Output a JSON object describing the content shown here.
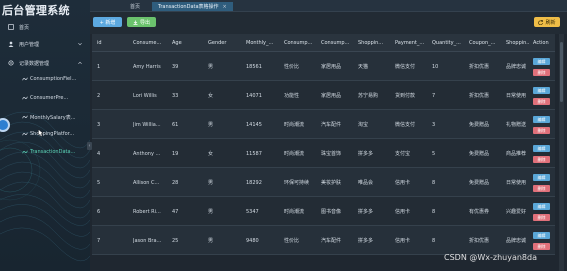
{
  "app": {
    "title": "后台管理系统"
  },
  "sidebar": {
    "items": [
      {
        "label": "首页",
        "icon": "home-icon"
      },
      {
        "label": "用户管理",
        "icon": "user-icon"
      },
      {
        "label": "记录数据管理",
        "icon": "data-icon"
      }
    ],
    "subitems": [
      {
        "label": "ConsumptionFiel..."
      },
      {
        "label": "ConsumerPre..."
      },
      {
        "label": "MonthlySalary表..."
      },
      {
        "label": "ShoppingPlatfor..."
      },
      {
        "label": "TransactionData..."
      }
    ]
  },
  "tabs": [
    {
      "label": "首页"
    },
    {
      "label": "TransactionData表格操作"
    }
  ],
  "toolbar": {
    "add_label": "+ 新增",
    "export_label": "导出",
    "refresh_label": "刷新"
  },
  "table": {
    "columns": [
      "id",
      "Consume...",
      "Age",
      "Gender",
      "Monthly_...",
      "Consump...",
      "Consump...",
      "Shoppin...",
      "Payment_...",
      "Quantity_...",
      "Coupon_...",
      "Shoppin...",
      "Action"
    ],
    "rows": [
      {
        "id": "1",
        "name": "Amy Harris",
        "age": "39",
        "gender": "男",
        "salary": "18561",
        "c1": "性价比",
        "c2": "家居用品",
        "shop": "天猫",
        "pay": "微信支付",
        "qty": "10",
        "coupon": "折扣优惠",
        "s2": "品牌忠诚"
      },
      {
        "id": "2",
        "name": "Lori Willis",
        "age": "33",
        "gender": "女",
        "salary": "14071",
        "c1": "功能性",
        "c2": "家居用品",
        "shop": "苏宁易购",
        "pay": "货到付款",
        "qty": "7",
        "coupon": "折扣优惠",
        "s2": "日常使用"
      },
      {
        "id": "3",
        "name": "Jim Willia...",
        "age": "61",
        "gender": "男",
        "salary": "14145",
        "c1": "时尚潮流",
        "c2": "汽车配件",
        "shop": "淘宝",
        "pay": "微信支付",
        "qty": "3",
        "coupon": "免费赠品",
        "s2": "礼物赠送"
      },
      {
        "id": "4",
        "name": "Anthony ...",
        "age": "19",
        "gender": "女",
        "salary": "11587",
        "c1": "时尚潮流",
        "c2": "珠宝首饰",
        "shop": "拼多多",
        "pay": "支付宝",
        "qty": "5",
        "coupon": "免费赠品",
        "s2": "商品推荐"
      },
      {
        "id": "5",
        "name": "Allison C...",
        "age": "28",
        "gender": "男",
        "salary": "18292",
        "c1": "环保可持续",
        "c2": "美妆护肤",
        "shop": "唯品会",
        "pay": "信用卡",
        "qty": "8",
        "coupon": "免费赠品",
        "s2": "日常使用"
      },
      {
        "id": "6",
        "name": "Robert Ri...",
        "age": "47",
        "gender": "男",
        "salary": "5347",
        "c1": "时尚潮流",
        "c2": "图书音像",
        "shop": "拼多多",
        "pay": "信用卡",
        "qty": "8",
        "coupon": "有优惠券",
        "s2": "兴趣爱好"
      },
      {
        "id": "7",
        "name": "Jason Bra...",
        "age": "25",
        "gender": "男",
        "salary": "9480",
        "c1": "性价比",
        "c2": "汽车配件",
        "shop": "拼多多",
        "pay": "信用卡",
        "qty": "8",
        "coupon": "折扣优惠",
        "s2": "品牌忠诚"
      }
    ],
    "edit_label": "编辑",
    "delete_label": "删除"
  },
  "watermark": "CSDN @Wx-zhuyan8da"
}
